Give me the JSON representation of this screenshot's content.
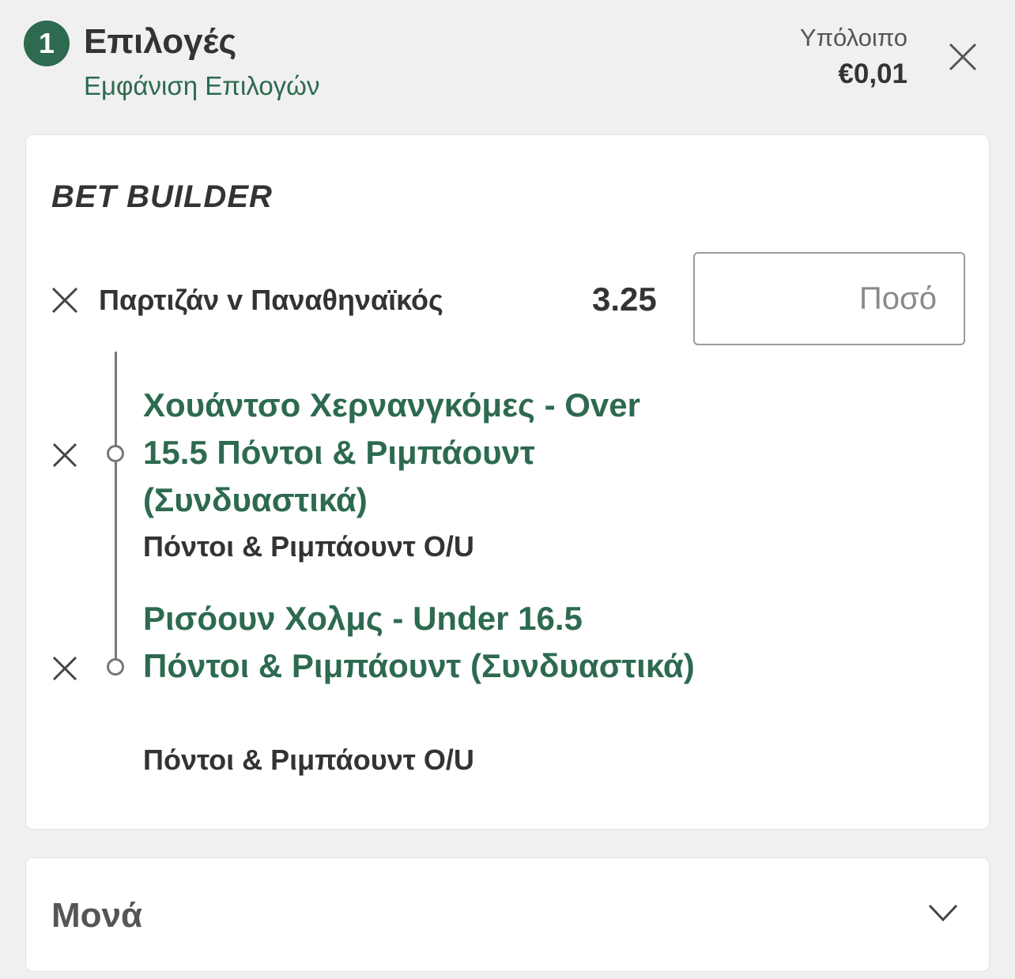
{
  "header": {
    "selection_count": "1",
    "title": "Επιλογές",
    "show_selections": "Εμφάνιση Επιλογών",
    "balance_label": "Υπόλοιπο",
    "balance_value": "€0,01"
  },
  "bet_builder": {
    "title": "BET BUILDER",
    "match": "Παρτιζάν v Παναθηναϊκός",
    "odds": "3.25",
    "stake_placeholder": "Ποσό",
    "selections": [
      {
        "name": " Χουάντσο Χερνανγκόμες - Over 15.5 Πόντοι & Ριμπάουντ (Συνδυαστικά)",
        "market": "Πόντοι & Ριμπάουντ O/U"
      },
      {
        "name": " Ρισόουν Χολμς - Under 16.5 Πόντοι & Ριμπάουντ (Συνδυαστικά)",
        "market": "Πόντοι & Ριμπάουντ O/U"
      }
    ]
  },
  "singles": {
    "label": "Μονά"
  },
  "colors": {
    "accent": "#2d6a4f",
    "background": "#f0f0f0",
    "card": "#ffffff"
  },
  "icons": [
    "close-icon",
    "remove-icon",
    "chevron-down-icon"
  ]
}
